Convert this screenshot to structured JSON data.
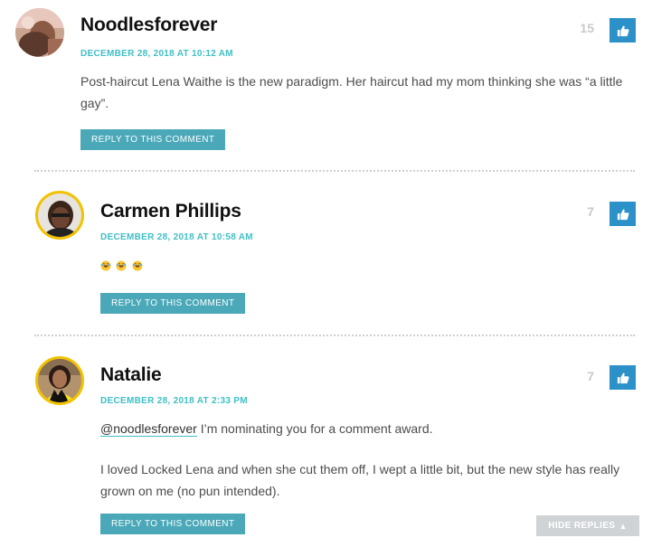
{
  "comments": [
    {
      "author": "Noodlesforever",
      "date": "December 28, 2018 at 10:12 AM",
      "paragraphs": [
        "Post-haircut Lena Waithe is the new paradigm. Her haircut had my mom thinking she was “a little gay”."
      ],
      "reply_label": "Reply to this comment",
      "like_count": "15",
      "like_icon": "thumbs-up-icon"
    },
    {
      "author": "Carmen Phillips",
      "date": "December 28, 2018 at 10:58 AM",
      "emoji": [
        "😂",
        "😂",
        "😂"
      ],
      "reply_label": "Reply to this comment",
      "like_count": "7",
      "like_icon": "thumbs-up-icon"
    },
    {
      "author": "Natalie",
      "date": "December 28, 2018 at 2:33 PM",
      "mention": "@noodlesforever",
      "mention_rest": " I’m nominating you for a comment award.",
      "paragraph2": "I loved Locked Lena and when she cut them off, I wept a little bit, but the new style has really grown on me (no pun intended).",
      "reply_label": "Reply to this comment",
      "like_count": "7",
      "like_icon": "thumbs-up-icon"
    }
  ],
  "hide_replies": {
    "label": "Hide Replies",
    "icon": "triangle-up-icon"
  },
  "colors": {
    "accent": "#3fbfc6",
    "reply_button": "#4aa8b8",
    "like_button": "#2c91c9",
    "author": "#111111"
  }
}
